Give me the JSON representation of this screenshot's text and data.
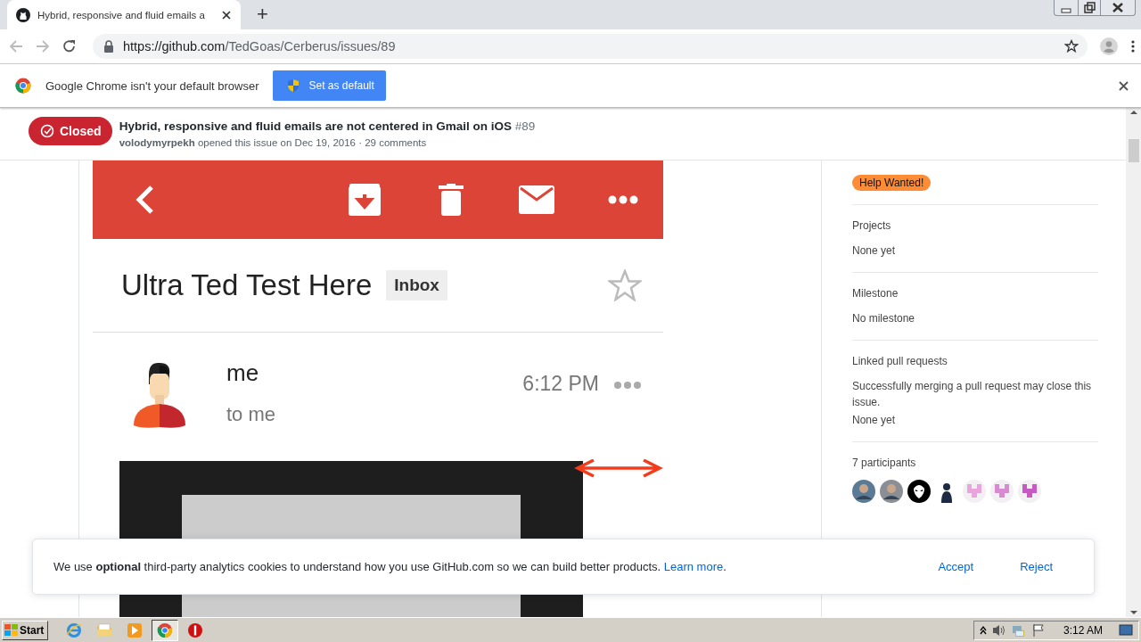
{
  "browser": {
    "tabs": [
      {
        "title": "Hybrid, responsive and fluid emails a",
        "selected": true
      }
    ],
    "new_tab": "+",
    "url": {
      "domain": "https://github.com",
      "path": "/TedGoas/Cerberus/issues/89"
    }
  },
  "infobar": {
    "message": "Google Chrome isn't your default browser",
    "button": "Set as default"
  },
  "issue": {
    "state": "Closed",
    "title": "Hybrid, responsive and fluid emails are not centered in Gmail on iOS",
    "number": "#89",
    "author": "volodymyrpekh",
    "meta": "opened this issue on Dec 19, 2016 · 29 comments"
  },
  "email": {
    "subject": "Ultra Ted Test Here",
    "label": "Inbox",
    "starred": false,
    "sender": "me",
    "recipient": "to me",
    "time": "6:12 PM"
  },
  "sidebar": {
    "labels": [
      {
        "text": "Help Wanted!",
        "color": "#fd8c34"
      }
    ],
    "sections": [
      {
        "heading": "Projects",
        "lines": [
          "None yet"
        ]
      },
      {
        "heading": "Milestone",
        "lines": [
          "No milestone"
        ]
      },
      {
        "heading": "Linked pull requests",
        "lines": [
          "Successfully merging a pull request may close this issue.",
          "None yet"
        ]
      }
    ],
    "participants_heading": "7 participants",
    "participants": [
      {
        "kind": "photo",
        "color": "#5a7a96"
      },
      {
        "kind": "photo",
        "color": "#8a8f96"
      },
      {
        "kind": "alien",
        "color": "#000000"
      },
      {
        "kind": "figure",
        "color": "#1c2a44"
      },
      {
        "kind": "identicon",
        "color": "#e9a4dc"
      },
      {
        "kind": "identicon",
        "color": "#d98ad0"
      },
      {
        "kind": "identicon",
        "color": "#c659c2"
      }
    ]
  },
  "cookie": {
    "text": "We use **optional** third-party analytics cookies to understand how you use GitHub.com so we can build better products.",
    "link": "Learn more",
    "after": ".",
    "buttons": [
      "Accept",
      "Reject"
    ]
  },
  "taskbar": {
    "start": "Start",
    "apps": [
      {
        "kind": "ie",
        "selected": false
      },
      {
        "kind": "folder",
        "selected": false
      },
      {
        "kind": "media",
        "selected": false
      },
      {
        "kind": "chrome",
        "selected": true
      },
      {
        "kind": "stop",
        "selected": false
      }
    ],
    "clock": "3:12 AM"
  }
}
